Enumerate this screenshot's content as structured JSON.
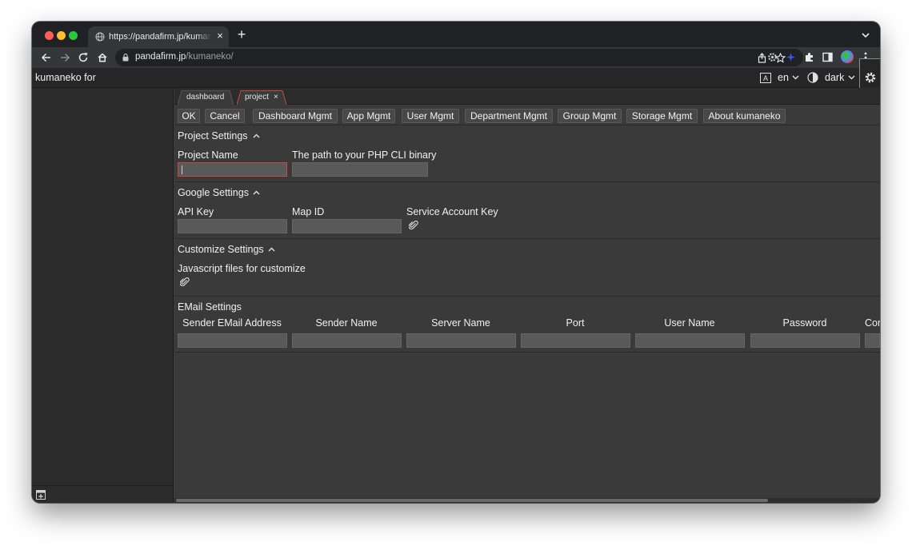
{
  "browser": {
    "tab_title": "https://pandafirm.jp/kumaneko/",
    "tab_close": "×",
    "new_tab": "+",
    "url_host": "pandafirm.jp",
    "url_path": "/kumaneko/"
  },
  "app": {
    "title": "kumaneko for",
    "language": "en",
    "theme": "dark"
  },
  "pane_tabs": [
    {
      "label": "dashboard",
      "active": false
    },
    {
      "label": "project",
      "active": true,
      "close": "×"
    }
  ],
  "toolbar_buttons": [
    "OK",
    "Cancel",
    "Dashboard Mgmt",
    "App Mgmt",
    "User Mgmt",
    "Department Mgmt",
    "Group Mgmt",
    "Storage Mgmt",
    "About kumaneko"
  ],
  "project_settings": {
    "title": "Project Settings",
    "fields": [
      {
        "label": "Project Name",
        "value": ""
      },
      {
        "label": "The path to your PHP CLI binary",
        "value": ""
      }
    ]
  },
  "google_settings": {
    "title": "Google Settings",
    "fields": [
      {
        "label": "API Key",
        "value": ""
      },
      {
        "label": "Map ID",
        "value": ""
      },
      {
        "label": "Service Account Key"
      }
    ]
  },
  "customize_settings": {
    "title": "Customize Settings",
    "fields": [
      {
        "label": "Javascript files for customize"
      }
    ]
  },
  "email_settings": {
    "title": "EMail Settings",
    "columns": [
      "Sender EMail Address",
      "Sender Name",
      "Server Name",
      "Port",
      "User Name",
      "Password",
      "Con"
    ]
  },
  "colors": {
    "accent_focus": "#c64b3e",
    "tab_active_border": "#c64b3e",
    "content_bg": "#3a3a3a",
    "sidebar_bg": "#2b2b2b"
  }
}
